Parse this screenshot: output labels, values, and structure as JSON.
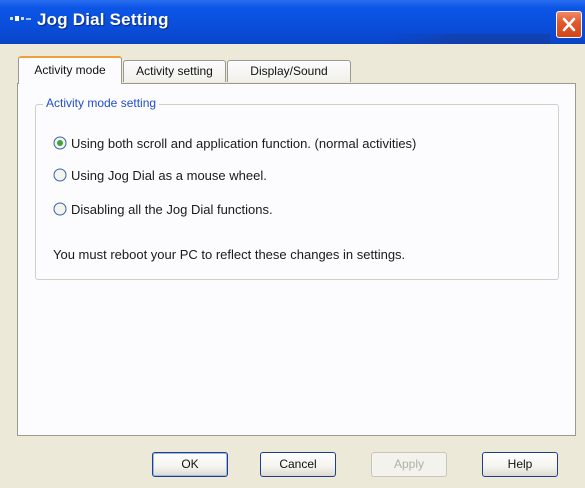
{
  "window": {
    "title": "Jog Dial Setting"
  },
  "tabs": [
    {
      "label": "Activity mode",
      "selected": true
    },
    {
      "label": "Activity setting",
      "selected": false
    },
    {
      "label": "Display/Sound",
      "selected": false
    }
  ],
  "activity_mode": {
    "group_label": "Activity mode setting",
    "options": [
      {
        "label": "Using both scroll and application function. (normal activities)",
        "selected": true
      },
      {
        "label": "Using Jog Dial as a mouse wheel.",
        "selected": false
      },
      {
        "label": "Disabling all the Jog Dial functions.",
        "selected": false
      }
    ],
    "note": "You must reboot your PC to reflect these changes in settings."
  },
  "buttons": {
    "ok": "OK",
    "cancel": "Cancel",
    "apply": "Apply",
    "help": "Help"
  },
  "colors": {
    "titlebar": "#0a4fdc",
    "close": "#d2451a",
    "active_tab_accent": "#f0a03a",
    "group_label": "#1f4ecb"
  },
  "icons": {
    "app": "jog-dial-icon",
    "close": "close-icon",
    "radio_selected": "radio-selected-icon",
    "radio_unselected": "radio-unselected-icon"
  }
}
